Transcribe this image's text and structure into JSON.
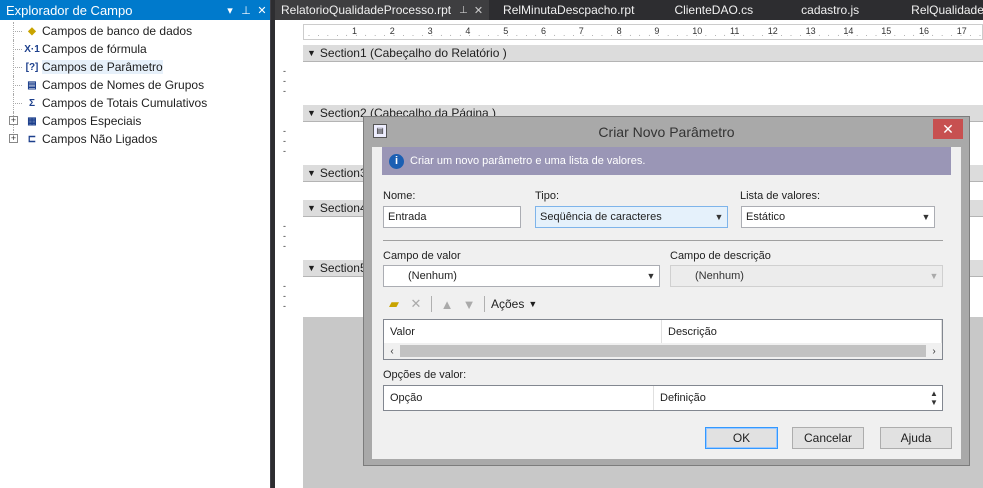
{
  "left_panel": {
    "title": "Explorador de Campo",
    "title_buttons": [
      "▾",
      "⊥",
      "✕"
    ],
    "items": [
      {
        "label": "Campos de banco de dados",
        "icon": "database-icon",
        "glyph": "◆",
        "expandable": false
      },
      {
        "label": "Campos de fórmula",
        "icon": "formula-icon",
        "glyph": "X·1",
        "expandable": false
      },
      {
        "label": "Campos de Parâmetro",
        "icon": "parameter-icon",
        "glyph": "[?]",
        "expandable": false,
        "selected": true
      },
      {
        "label": "Campos de Nomes de Grupos",
        "icon": "group-name-icon",
        "glyph": "▤",
        "expandable": false
      },
      {
        "label": "Campos de Totais Cumulativos",
        "icon": "running-total-icon",
        "glyph": "Σ",
        "expandable": false
      },
      {
        "label": "Campos Especiais",
        "icon": "special-fields-icon",
        "glyph": "▦",
        "expandable": true
      },
      {
        "label": "Campos Não Ligados",
        "icon": "unbound-fields-icon",
        "glyph": "⊏",
        "expandable": true
      }
    ]
  },
  "tabs": [
    {
      "label": "RelatorioQualidadeProcesso.rpt",
      "active": true,
      "pin": "⊥",
      "close": "✕"
    },
    {
      "label": "RelMinutaDescpacho.rpt"
    },
    {
      "label": "ClienteDAO.cs"
    },
    {
      "label": "cadastro.js"
    },
    {
      "label": "RelQualidadePr"
    }
  ],
  "designer": {
    "ruler_numbers": [
      "1",
      "2",
      "3",
      "4",
      "5",
      "6",
      "7",
      "8",
      "9",
      "10",
      "11",
      "12",
      "13",
      "14",
      "15",
      "16",
      "17"
    ],
    "sections": [
      {
        "label": "Section1 (Cabeçalho do Relatório  )"
      },
      {
        "label": "Section2 (Cabeçalho da Página  )"
      },
      {
        "label": "Section3"
      },
      {
        "label": "Section4"
      },
      {
        "label": "Section5"
      }
    ]
  },
  "dialog": {
    "title": "Criar Novo Parâmetro",
    "close_glyph": "✕",
    "info_text": "Criar um novo parâmetro e uma lista de valores.",
    "nome_label": "Nome:",
    "nome_value": "Entrada",
    "tipo_label": "Tipo:",
    "tipo_value": "Seqüência de caracteres",
    "lista_label": "Lista de valores:",
    "lista_value": "Estático",
    "campo_valor_label": "Campo de valor",
    "campo_valor_value": "(Nenhum)",
    "campo_descricao_label": "Campo de descrição",
    "campo_descricao_value": "(Nenhum)",
    "toolbar": {
      "acoes_label": "Ações"
    },
    "values_grid": {
      "columns": [
        "Valor",
        "Descrição"
      ]
    },
    "opcoes_label": "Opções de valor:",
    "options_grid": {
      "columns": [
        "Opção",
        "Definição"
      ]
    },
    "buttons": {
      "ok": "OK",
      "cancel": "Cancelar",
      "help": "Ajuda"
    }
  }
}
